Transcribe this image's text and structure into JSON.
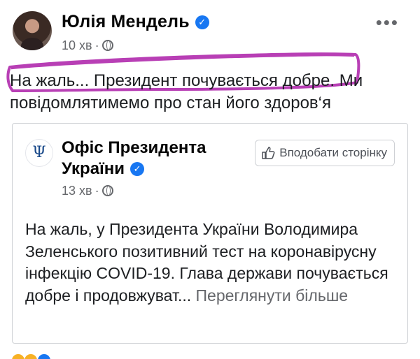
{
  "post": {
    "author": "Юлія Мендель",
    "time": "10 хв",
    "text": "На жаль... Президент почувається добре. Ми повідомлятимемо про стан його здоров‘я",
    "highlight_color": "#b83fb5"
  },
  "shared": {
    "page_name": "Офіс Президента України",
    "like_button": "Вподобати сторінку",
    "time": "13 хв",
    "text": "На жаль, у Президента України Володимира Зеленського позитивний тест на коронавірусну інфекцію COVID-19. Глава держави почувається добре і продовжуват...",
    "see_more": "Переглянути більше"
  },
  "icons": {
    "verified": "verified-badge-icon",
    "globe": "globe-icon",
    "more": "more-options-icon",
    "thumb": "thumbs-up-icon"
  },
  "colors": {
    "accent": "#1877f2",
    "meta": "#65676b"
  }
}
